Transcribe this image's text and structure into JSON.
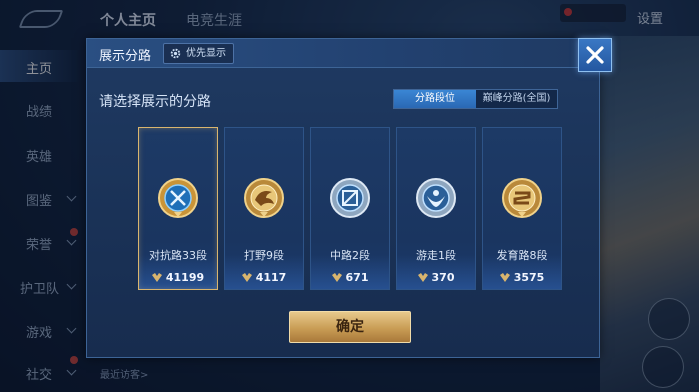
{
  "topbar": {
    "tabs": [
      "个人主页",
      "电竞生涯"
    ],
    "settings_label": "设置"
  },
  "sidebar": {
    "items": [
      {
        "label": "主页",
        "active": true,
        "has_chevron": false
      },
      {
        "label": "战绩",
        "active": false,
        "has_chevron": false
      },
      {
        "label": "英雄",
        "active": false,
        "has_chevron": false
      },
      {
        "label": "图鉴",
        "active": false,
        "has_chevron": true
      },
      {
        "label": "荣誉",
        "active": false,
        "has_chevron": true
      },
      {
        "label": "护卫队",
        "active": false,
        "has_chevron": true
      },
      {
        "label": "游戏",
        "active": false,
        "has_chevron": true
      },
      {
        "label": "社交",
        "active": false,
        "has_chevron": true
      }
    ]
  },
  "footer": {
    "recent_visitors": "最近访客>"
  },
  "modal": {
    "title": "展示分路",
    "priority_label": "优先显示",
    "prompt": "请选择展示的分路",
    "segment": {
      "option_a": "分路段位",
      "option_b": "巅峰分路(全国)",
      "selected": "option_a"
    },
    "cards": [
      {
        "name": "对抗路33段",
        "stat": "41199",
        "icon": "clash-lane-emblem-icon",
        "selected": true
      },
      {
        "name": "打野9段",
        "stat": "4117",
        "icon": "jungle-emblem-icon",
        "selected": false
      },
      {
        "name": "中路2段",
        "stat": "671",
        "icon": "mid-lane-emblem-icon",
        "selected": false
      },
      {
        "name": "游走1段",
        "stat": "370",
        "icon": "roam-emblem-icon",
        "selected": false
      },
      {
        "name": "发育路8段",
        "stat": "3575",
        "icon": "farm-lane-emblem-icon",
        "selected": false
      }
    ],
    "confirm_label": "确定"
  },
  "colors": {
    "accent_blue": "#2a68b4",
    "gold_button": "#c99d55",
    "selected_border": "#d9b56e",
    "modal_bg": "#1a3257"
  }
}
